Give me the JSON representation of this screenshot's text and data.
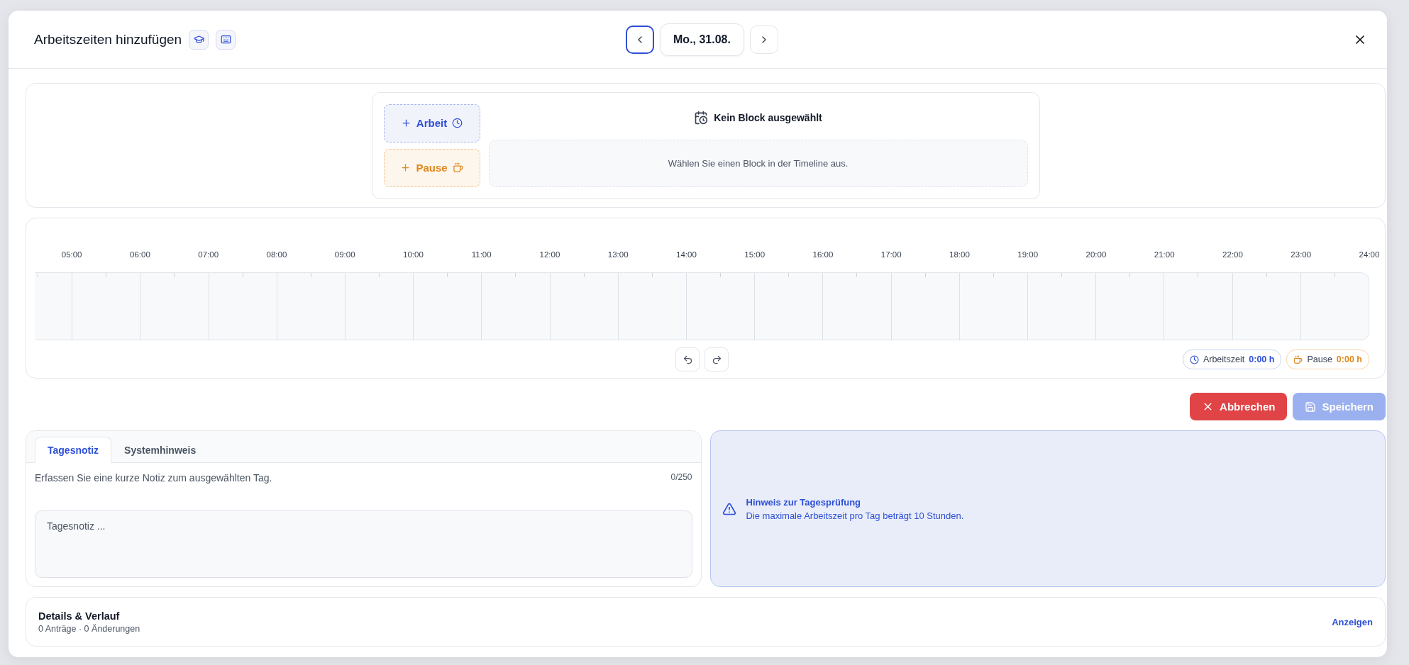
{
  "dialog": {
    "title": "Arbeitszeiten hinzufügen",
    "date": "Mo., 31.08."
  },
  "add_buttons": [
    {
      "kind": "work",
      "label": "Arbeit"
    },
    {
      "kind": "pause",
      "label": "Pause"
    }
  ],
  "selection": {
    "title": "Kein Block ausgewählt",
    "hint": "Wählen Sie einen Block in der Timeline aus."
  },
  "timeline": {
    "hours": [
      "05:00",
      "06:00",
      "07:00",
      "08:00",
      "09:00",
      "10:00",
      "11:00",
      "12:00",
      "13:00",
      "14:00",
      "15:00",
      "16:00",
      "17:00",
      "18:00",
      "19:00",
      "20:00",
      "21:00",
      "22:00",
      "23:00",
      "24:00"
    ]
  },
  "totals": [
    {
      "kind": "work",
      "label": "Arbeitszeit",
      "value": "0:00 h"
    },
    {
      "kind": "pause",
      "label": "Pause",
      "value": "0:00 h"
    }
  ],
  "actions": [
    {
      "kind": "cancel",
      "label": "Abbrechen",
      "disabled": false
    },
    {
      "kind": "save",
      "label": "Speichern",
      "disabled": true
    }
  ],
  "tabs": [
    {
      "label": "Tagesnotiz",
      "selected": true
    },
    {
      "label": "Systemhinweis",
      "selected": false
    }
  ],
  "note": {
    "description": "Erfassen Sie eine kurze Notiz zum ausgewählten Tag.",
    "counter": "0/250",
    "placeholder": "Tagesnotiz ..."
  },
  "hint": {
    "title": "Hinweis zur Tagesprüfung",
    "text": "Die maximale Arbeitszeit pro Tag beträgt 10 Stunden."
  },
  "details": {
    "title": "Details & Verlauf",
    "subtitle": "0 Anträge · 0 Änderungen",
    "link": "Anzeigen"
  }
}
